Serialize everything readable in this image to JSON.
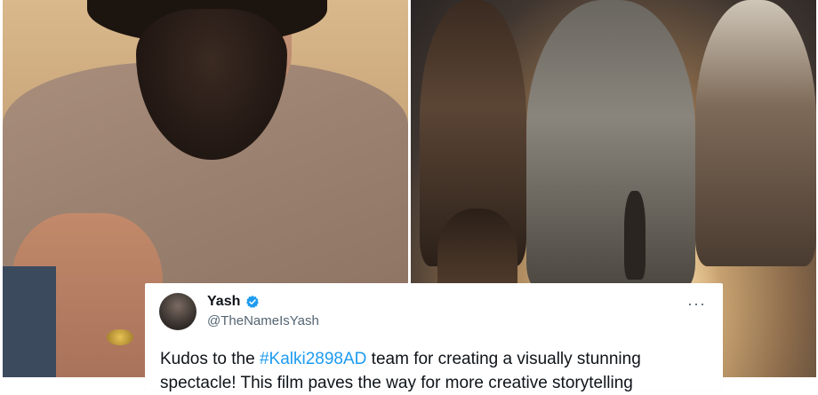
{
  "tweet": {
    "author_name": "Yash",
    "handle": "@TheNameIsYash",
    "text_before": "Kudos to the ",
    "hashtag": "#Kalki2898AD",
    "text_after": " team for creating a visually stunning",
    "line2": "spectacle! This film paves the way for more creative storytelling",
    "verified_color": "#1d9bf0",
    "more_icon": "ellipsis-icon"
  },
  "colors": {
    "hashtag": "#1d9bf0",
    "text": "#0f1419",
    "secondary": "#536471"
  }
}
